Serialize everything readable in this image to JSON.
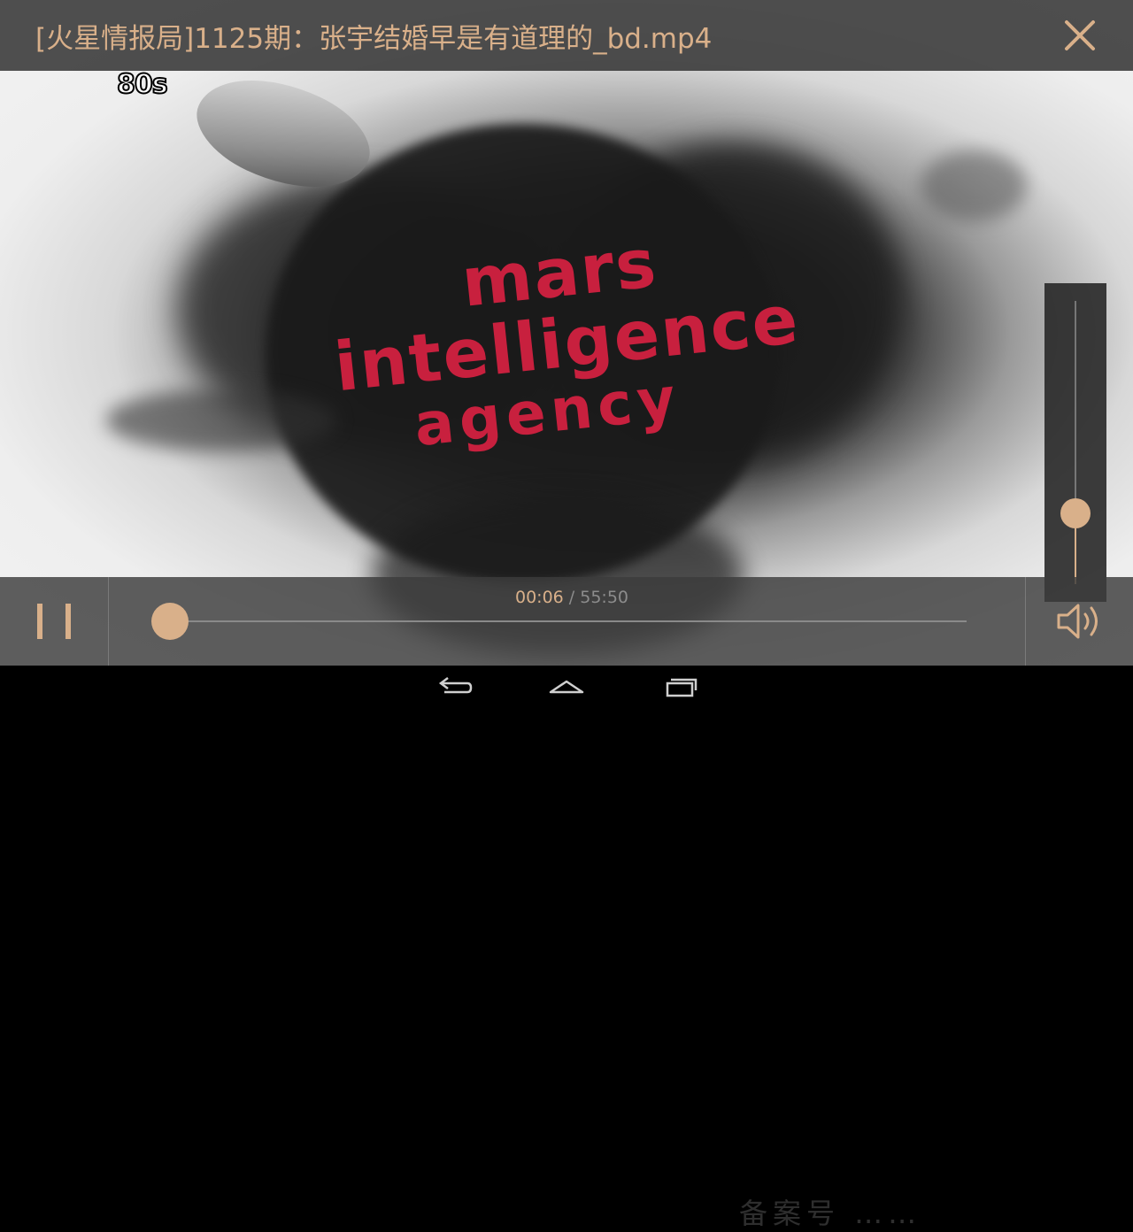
{
  "video": {
    "channel_logo": "80s",
    "title_line1": "mars intelligence",
    "title_line2": "agency",
    "watermark": "备案号 ……",
    "accent_color": "#c8203e"
  },
  "header": {
    "title": "[火星情报局]1125期：张宇结婚早是有道理的_bd.mp4",
    "close_icon": "close-icon",
    "accent_color": "#d9b08a"
  },
  "volume": {
    "level": 0.25,
    "icon": "speaker-icon"
  },
  "controls": {
    "current_time": "00:06",
    "separator": " / ",
    "duration": "55:50",
    "progress": 0.0018,
    "pause_icon": "pause-icon"
  },
  "navbar": {
    "back_icon": "back-icon",
    "home_icon": "home-icon",
    "recents_icon": "recents-icon"
  }
}
